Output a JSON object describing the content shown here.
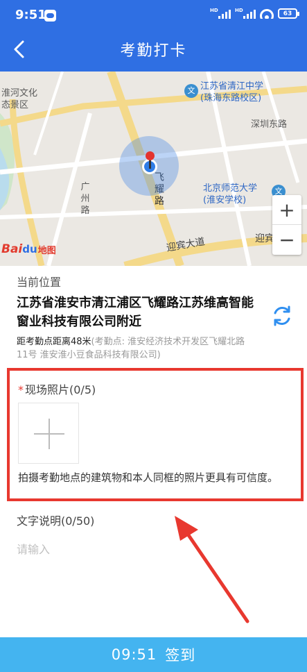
{
  "status_bar": {
    "time": "9:51",
    "network_label_1": "HD",
    "network_label_2": "HD",
    "battery": "63"
  },
  "nav": {
    "back_icon": "chevron-left-icon",
    "title": "考勤打卡"
  },
  "map": {
    "labels": {
      "park_name": "淮河文化\n态景区",
      "school_1": "江苏省清江中学\n(珠海东路校区)",
      "road_shenzhen": "深圳东路",
      "road_feiyao": "飞\n耀\n路",
      "road_guangzhou": "广\n州\n路",
      "school_2": "北京师范大学\n(淮安学校)",
      "road_yingbin": "迎宾大道",
      "road_yingbin_right": "迎宾"
    },
    "logo_bai": "Bai",
    "logo_du": "du",
    "logo_ditu": "地图",
    "zoom_in": "+",
    "zoom_out": "−"
  },
  "location": {
    "caption": "当前位置",
    "address": "江苏省淮安市清江浦区飞耀路江苏维高智能窗业科技有限公司附近",
    "distance_text": "距考勤点距离48米",
    "attendance_point": "(考勤点: 淮安经济技术开发区飞耀北路11号 淮安淮小豆食品科技有限公司)",
    "refresh_icon": "refresh-icon"
  },
  "photo": {
    "required_mark": "*",
    "title": "现场照片(0/5)",
    "hint": "拍摄考勤地点的建筑物和本人同框的照片更具有可信度。"
  },
  "description": {
    "title": "文字说明(0/50)",
    "placeholder": "请输入"
  },
  "submit": {
    "time": "09:51",
    "label": "签到"
  },
  "colors": {
    "header": "#2f6fe3",
    "button": "#44b4f0",
    "highlight": "#e8382f"
  }
}
